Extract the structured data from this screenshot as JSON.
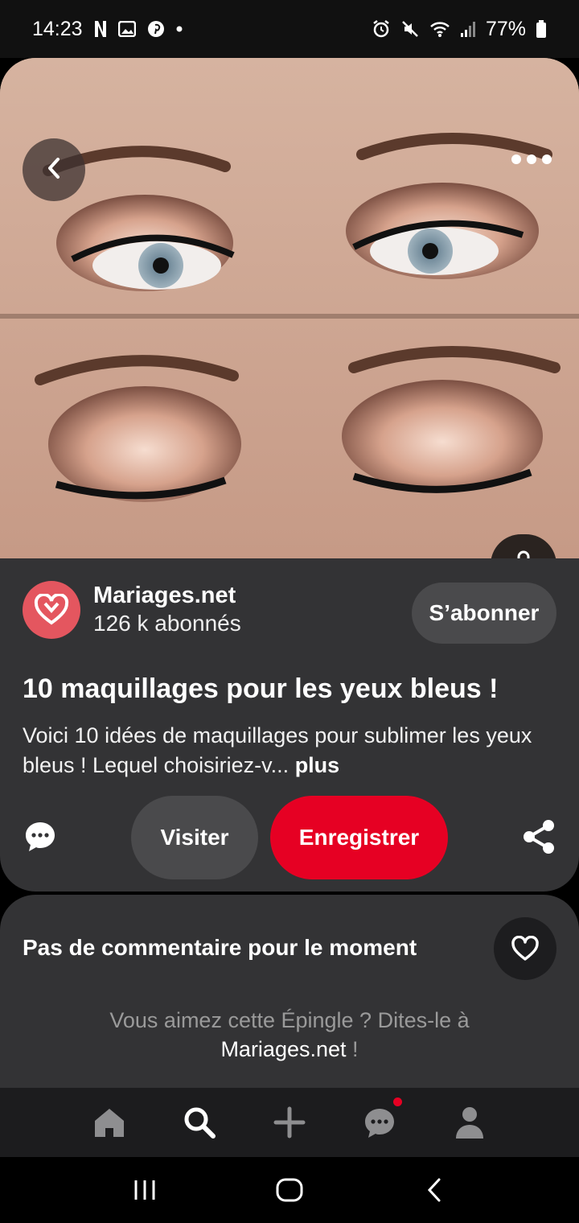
{
  "status_bar": {
    "time": "14:23",
    "battery": "77%",
    "icons": [
      "netflix-icon",
      "gallery-icon",
      "pinterest-icon",
      "dot-icon",
      "alarm-icon",
      "mute-icon",
      "wifi-icon",
      "signal-icon",
      "battery-icon"
    ]
  },
  "hero": {
    "image_description": "before and after eye makeup photo",
    "back_icon": "back-chevron-icon",
    "more_icon": "more-dots-icon",
    "shop_icon": "shopping-bag-icon"
  },
  "author": {
    "name": "Mariages.net",
    "subscribers": "126 k abonnés",
    "subscribe_label": "S’abonner",
    "avatar_color": "#e4565f"
  },
  "pin": {
    "title": "10 maquillages pour les yeux bleus !",
    "description": "Voici 10 idées de maquillages pour sublimer les yeux bleus ! Lequel choisiriez-v...",
    "more_label": "plus"
  },
  "actions": {
    "visit_label": "Visiter",
    "save_label": "Enregistrer",
    "save_color": "#e60023"
  },
  "comments": {
    "empty_label": "Pas de commentaire pour le moment",
    "prompt_text": "Vous aimez cette Épingle ? Dites-le à",
    "prompt_brand": "Mariages.net",
    "prompt_end": " !"
  },
  "bottom_nav": {
    "items": [
      "home-icon",
      "search-icon",
      "create-icon",
      "messages-icon",
      "profile-icon"
    ]
  },
  "system_nav": {
    "items": [
      "recent-apps-icon",
      "home-circle-icon",
      "back-icon"
    ]
  }
}
